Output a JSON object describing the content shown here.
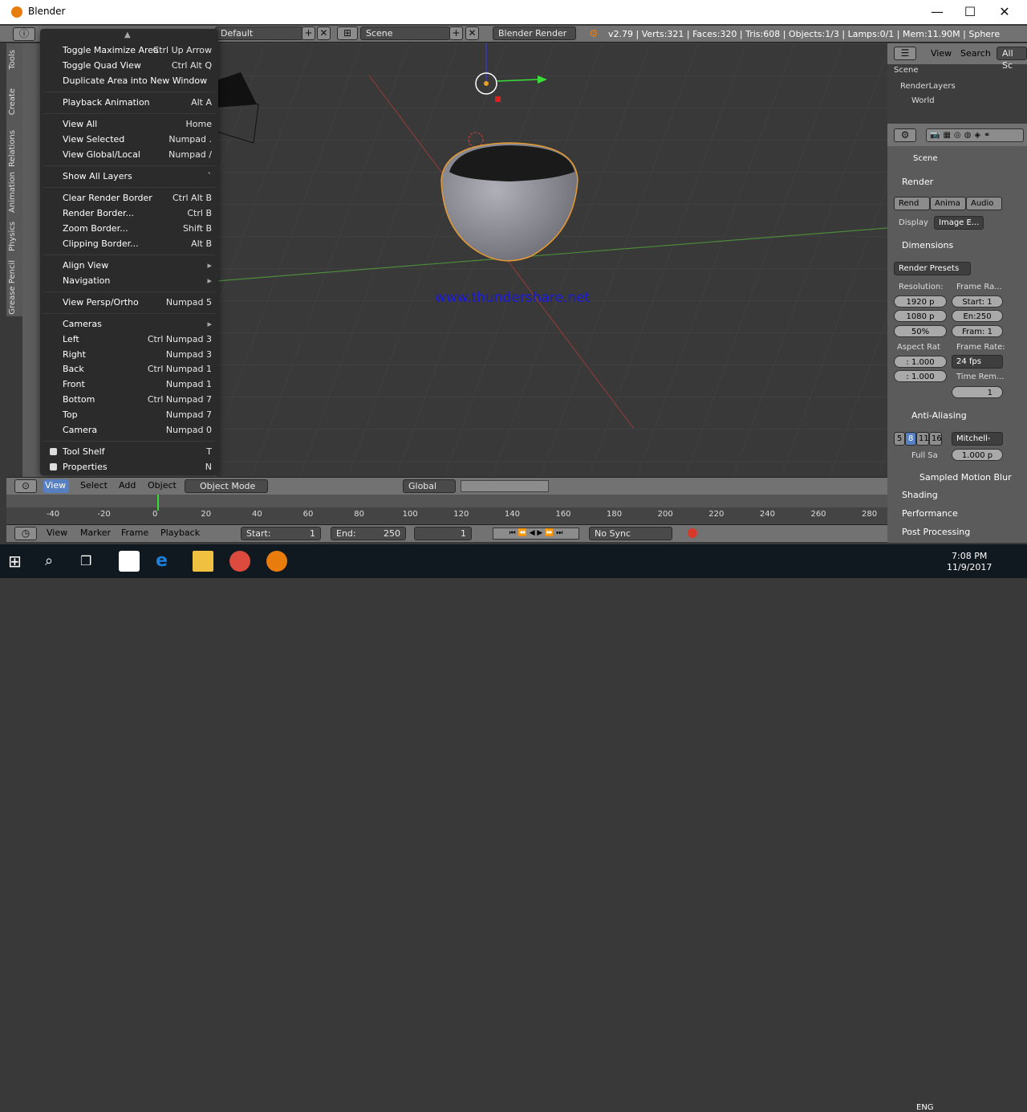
{
  "window": {
    "title": "Blender",
    "minimize": "—",
    "maximize": "☐",
    "close": "✕"
  },
  "info": {
    "screen_layout": "Default",
    "scene": "Scene",
    "engine": "Blender Render",
    "stats": "v2.79 | Verts:321 | Faces:320 | Tris:608 | Objects:1/3 | Lamps:0/1 | Mem:11.90M | Sphere"
  },
  "tool_tabs": [
    "Tools",
    "Create",
    "Relations",
    "Animation",
    "Physics",
    "Grease Pencil"
  ],
  "view_menu": {
    "items": [
      {
        "label": "Toggle Maximize Area",
        "shortcut": "Ctrl Up Arrow"
      },
      {
        "label": "Toggle Quad View",
        "shortcut": "Ctrl Alt Q"
      },
      {
        "label": "Duplicate Area into New Window",
        "shortcut": ""
      },
      {
        "label": "Playback Animation",
        "shortcut": "Alt A"
      },
      {
        "label": "View All",
        "shortcut": "Home"
      },
      {
        "label": "View Selected",
        "shortcut": "Numpad ."
      },
      {
        "label": "View Global/Local",
        "shortcut": "Numpad /"
      },
      {
        "label": "Show All Layers",
        "shortcut": "`"
      },
      {
        "label": "Clear Render Border",
        "shortcut": "Ctrl Alt B"
      },
      {
        "label": "Render Border...",
        "shortcut": "Ctrl B"
      },
      {
        "label": "Zoom Border...",
        "shortcut": "Shift B"
      },
      {
        "label": "Clipping Border...",
        "shortcut": "Alt B"
      },
      {
        "label": "Align View",
        "shortcut": ""
      },
      {
        "label": "Navigation",
        "shortcut": ""
      },
      {
        "label": "View Persp/Ortho",
        "shortcut": "Numpad 5"
      },
      {
        "label": "Cameras",
        "shortcut": ""
      },
      {
        "label": "Left",
        "shortcut": "Ctrl Numpad 3"
      },
      {
        "label": "Right",
        "shortcut": "Numpad 3"
      },
      {
        "label": "Back",
        "shortcut": "Ctrl Numpad 1"
      },
      {
        "label": "Front",
        "shortcut": "Numpad 1"
      },
      {
        "label": "Bottom",
        "shortcut": "Ctrl Numpad 7"
      },
      {
        "label": "Top",
        "shortcut": "Numpad 7"
      },
      {
        "label": "Camera",
        "shortcut": "Numpad 0"
      },
      {
        "label": "Tool Shelf",
        "shortcut": "T"
      },
      {
        "label": "Properties",
        "shortcut": "N"
      }
    ]
  },
  "viewport": {
    "watermark": "www.thundershare.net"
  },
  "header3d": {
    "view": "View",
    "select": "Select",
    "add": "Add",
    "object": "Object",
    "mode": "Object Mode",
    "orientation": "Global"
  },
  "timeline": {
    "ticks": [
      "-40",
      "-20",
      "0",
      "20",
      "40",
      "60",
      "80",
      "100",
      "120",
      "140",
      "160",
      "180",
      "200",
      "220",
      "240",
      "260",
      "280"
    ],
    "view": "View",
    "marker": "Marker",
    "frame": "Frame",
    "playback": "Playback",
    "start_label": "Start:",
    "start": "1",
    "end_label": "End:",
    "end": "250",
    "current": "1",
    "sync": "No Sync"
  },
  "outliner": {
    "view": "View",
    "search": "Search",
    "all": "All Sc",
    "items": [
      "Scene",
      "RenderLayers",
      "World"
    ]
  },
  "properties": {
    "context": "Scene",
    "render": "Render",
    "render_tabs": [
      "Rend",
      "Anima",
      "Audio"
    ],
    "display_label": "Display",
    "display": "Image E...",
    "dimensions": "Dimensions",
    "presets": "Render Presets",
    "resolution": "Resolution:",
    "res_x": "1920 p",
    "res_y": "1080 p",
    "res_pct": "50%",
    "frame_range": "Frame Ra...",
    "fstart": "Start: 1",
    "fend": "En:250",
    "fstep": "Fram: 1",
    "aspect": "Aspect Rat",
    "aspect_x": ": 1.000",
    "aspect_y": ": 1.000",
    "frame_rate": "Frame Rate:",
    "fps": "24 fps",
    "time_remap": "Time Rem...",
    "time_val": "1",
    "anti_aliasing": "Anti-Aliasing",
    "aa_samples": [
      "5",
      "8",
      "11",
      "16"
    ],
    "aa_filter": "Mitchell-",
    "full_sample": "Full Sa",
    "filter_size": "1.000 p",
    "sampled_motion": "Sampled Motion Blur",
    "shading": "Shading",
    "performance": "Performance",
    "post_processing": "Post Processing"
  },
  "taskbar": {
    "time": "7:08 PM",
    "date": "11/9/2017",
    "lang": "ENG"
  }
}
